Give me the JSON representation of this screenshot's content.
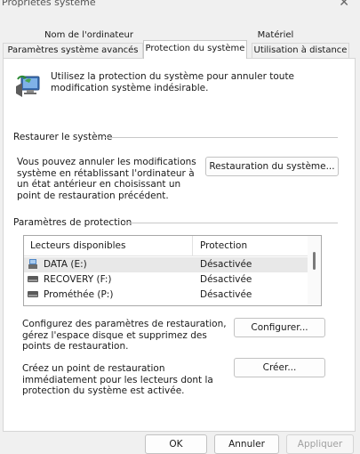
{
  "window": {
    "title": "Propriétés système",
    "close_glyph": "✕"
  },
  "tabs": {
    "row1": [
      "Nom de l'ordinateur",
      "Matériel"
    ],
    "row2": [
      "Paramètres système avancés",
      "Protection du système",
      "Utilisation à distance"
    ],
    "active": "Protection du système"
  },
  "header": {
    "description": "Utilisez la protection du système pour annuler toute modification système indésirable."
  },
  "restore": {
    "group_label": "Restaurer le système",
    "description": "Vous pouvez annuler les modifications système en rétablissant l'ordinateur à un état antérieur en choisissant un point de restauration précédent.",
    "button_label": "Restauration du système..."
  },
  "protection": {
    "group_label": "Paramètres de protection",
    "columns": [
      "Lecteurs disponibles",
      "Protection"
    ],
    "drives": [
      {
        "name": "DATA (E:)",
        "status": "Désactivée",
        "icon": "system-drive-icon"
      },
      {
        "name": "RECOVERY (F:)",
        "status": "Désactivée",
        "icon": "drive-icon"
      },
      {
        "name": "Prométhée (P:)",
        "status": "Désactivée",
        "icon": "drive-icon"
      }
    ]
  },
  "configure": {
    "description": "Configurez des paramètres de restauration, gérez l'espace disque et supprimez des points de restauration.",
    "button_label": "Configurer..."
  },
  "create": {
    "description": "Créez un point de restauration immédiatement pour les lecteurs dont la protection du système est activée.",
    "button_label": "Créer..."
  },
  "footer": {
    "ok_label": "OK",
    "cancel_label": "Annuler",
    "apply_label": "Appliquer"
  }
}
